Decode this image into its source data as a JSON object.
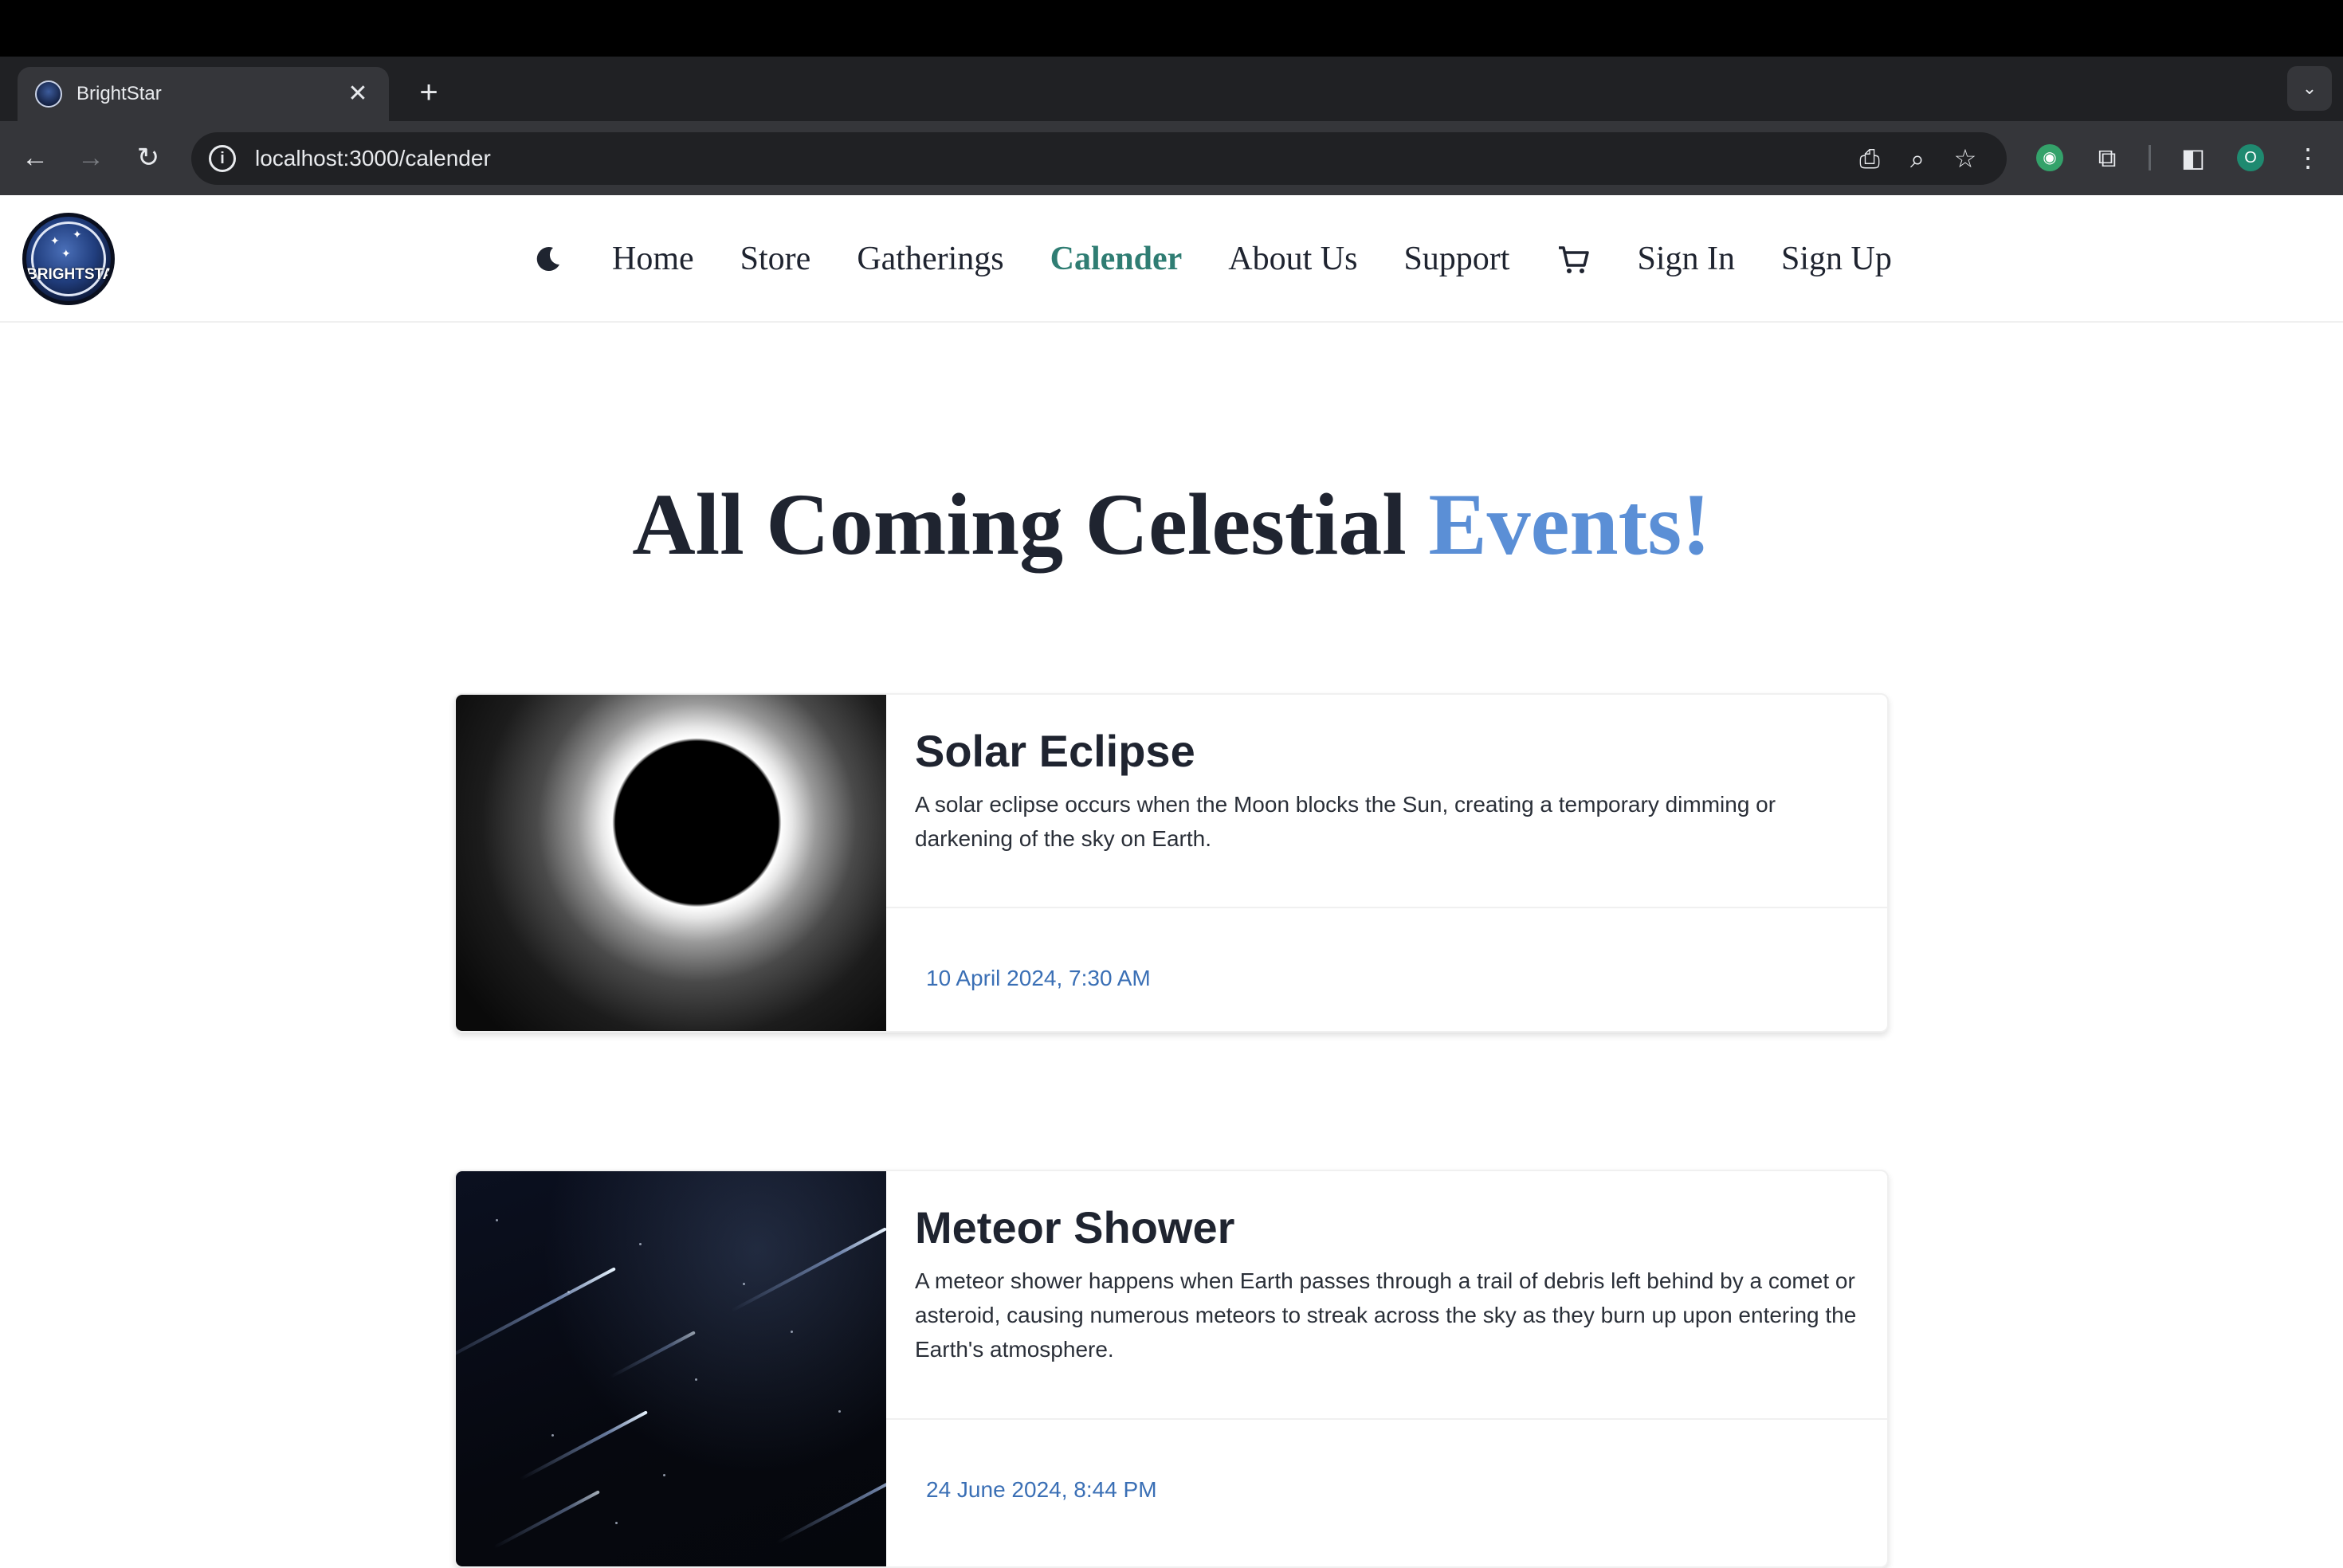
{
  "browser": {
    "tab_title": "BrightStar",
    "url": "localhost:3000/calender",
    "profile_initial": "O"
  },
  "nav": {
    "logo_text": "BRIGHTSTAR",
    "items": [
      "Home",
      "Store",
      "Gatherings",
      "Calender",
      "About Us",
      "Support",
      "Sign In",
      "Sign Up"
    ],
    "active": "Calender",
    "active_color": "#2f7d73"
  },
  "hero": {
    "title_main": "All Coming Celestial ",
    "title_accent": "Events!",
    "accent_color": "#5b8fd6"
  },
  "events": [
    {
      "title": "Solar Eclipse",
      "description": "A solar eclipse occurs when the Moon blocks the Sun, creating a temporary dimming or darkening of the sky on Earth.",
      "date": "10 April 2024, 7:30 AM"
    },
    {
      "title": "Meteor Shower",
      "description": "A meteor shower happens when Earth passes through a trail of debris left behind by a comet or asteroid, causing numerous meteors to streak across the sky as they burn up upon entering the Earth's atmosphere.",
      "date": "24 June 2024, 8:44 PM"
    }
  ],
  "date_color": "#3a6fb5"
}
